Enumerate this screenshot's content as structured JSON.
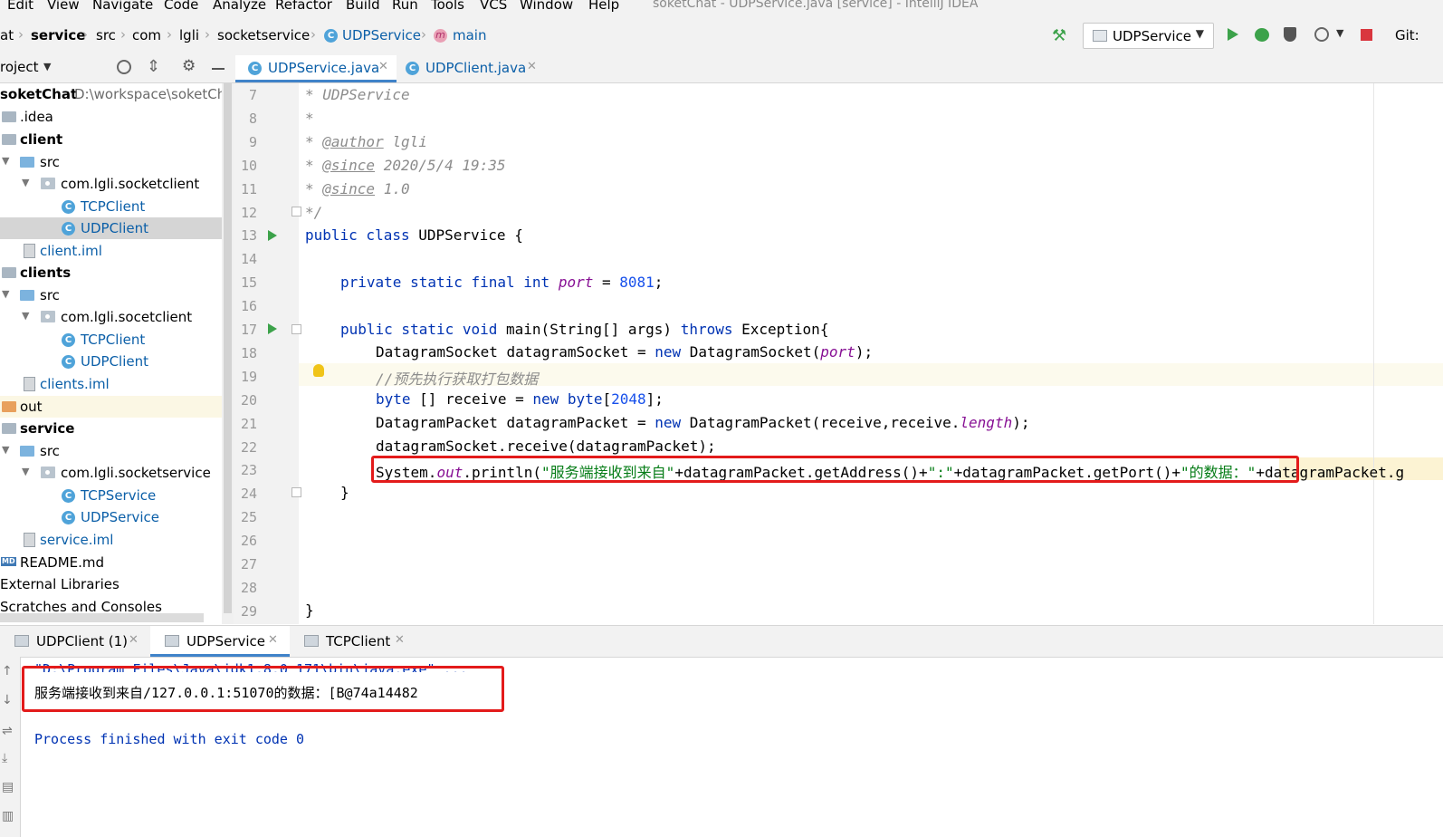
{
  "window_title": "soketChat - UDPService.java [service] - IntelliJ IDEA",
  "menu": [
    "Edit",
    "View",
    "Navigate",
    "Code",
    "Analyze",
    "Refactor",
    "Build",
    "Run",
    "Tools",
    "VCS",
    "Window",
    "Help"
  ],
  "breadcrumb": [
    "at",
    "service",
    "src",
    "com",
    "lgli",
    "socketservice",
    "UDPService",
    "main"
  ],
  "run_config": "UDPService",
  "git_label": "Git:",
  "project_header": "roject",
  "tabs": [
    {
      "label": "UDPService.java",
      "active": true
    },
    {
      "label": "UDPClient.java",
      "active": false
    }
  ],
  "tree": {
    "root": "soketChat",
    "root_path": "D:\\workspace\\soketChat",
    "items": [
      ".idea",
      "client",
      "src",
      "com.lgli.socketclient",
      "TCPClient",
      "UDPClient",
      "client.iml",
      "clients",
      "src",
      "com.lgli.socetclient",
      "TCPClient",
      "UDPClient",
      "clients.iml",
      "out",
      "service",
      "src",
      "com.lgli.socketservice",
      "TCPService",
      "UDPService",
      "service.iml",
      "README.md",
      "External Libraries",
      "Scratches and Consoles"
    ]
  },
  "editor": {
    "line_numbers": [
      "7",
      "8",
      "9",
      "10",
      "11",
      "12",
      "13",
      "14",
      "15",
      "16",
      "17",
      "18",
      "19",
      "20",
      "21",
      "22",
      "23",
      "24",
      "25",
      "26",
      "27",
      "28",
      "29"
    ],
    "line7": "* UDPService",
    "line8": "*",
    "line9_tag": "@author",
    "line9_val": " lgli",
    "line10_tag": "@since",
    "line10_val": " 2020/5/4 19:35",
    "line11_tag": "@since",
    "line11_val": " 1.0",
    "line12": "*/",
    "line13_kw": "public class",
    "line13_rest": " UDPService {",
    "line15_kw": "private static final int",
    "line15_fld": "port",
    "line15_eq": " = ",
    "line15_num": "8081",
    "line15_end": ";",
    "line17_kw": "public static void",
    "line17_mid": " main(String[] args) ",
    "line17_kw2": "throws",
    "line17_end": " Exception{",
    "line18_a": "DatagramSocket datagramSocket = ",
    "line18_kw": "new",
    "line18_b": " DatagramSocket(",
    "line18_fld": "port",
    "line18_c": ");",
    "line19_comment": "//预先执行获取打包数据",
    "line20_kw": "byte",
    "line20_a": " [] receive = ",
    "line20_kw2": "new byte",
    "line20_b": "[",
    "line20_num": "2048",
    "line20_c": "];",
    "line21_a": "DatagramPacket datagramPacket = ",
    "line21_kw": "new",
    "line21_b": " DatagramPacket(receive,receive.",
    "line21_fld": "length",
    "line21_c": ");",
    "line22": "datagramSocket.receive(datagramPacket);",
    "line23_a": "System.",
    "line23_fld": "out",
    "line23_b": ".println(",
    "line23_s1": "\"服务端接收到来自\"",
    "line23_c": "+datagramPacket.getAddress()+",
    "line23_s2": "\":\"",
    "line23_d": "+datagramPacket.getPort()+",
    "line23_s3": "\"的数据：\"",
    "line23_e": "+datagramPacket.g",
    "line24": "}",
    "line29": "}"
  },
  "run_tabs": [
    {
      "label": "UDPClient (1)",
      "active": false
    },
    {
      "label": "UDPService",
      "active": true
    },
    {
      "label": "TCPClient",
      "active": false
    }
  ],
  "console": {
    "cmd": "\"D:\\Program Files\\Java\\jdk1.8.0_171\\bin\\java.exe\" ...",
    "output": "服务端接收到来自/127.0.0.1:51070的数据：[B@74a14482",
    "finished": "Process finished with exit code 0"
  },
  "colors": {
    "highlight_red": "#e31b1b",
    "keyword": "#0033b3",
    "string": "#067d17",
    "field": "#871094",
    "number": "#1750eb",
    "comment": "#8c8c8c"
  },
  "icons": [
    "hammer-icon",
    "run-icon",
    "debug-icon",
    "coverage-icon",
    "profile-icon",
    "stop-icon",
    "target-icon",
    "collapse-icon",
    "gear-icon",
    "minimize-icon",
    "bulb-icon"
  ]
}
